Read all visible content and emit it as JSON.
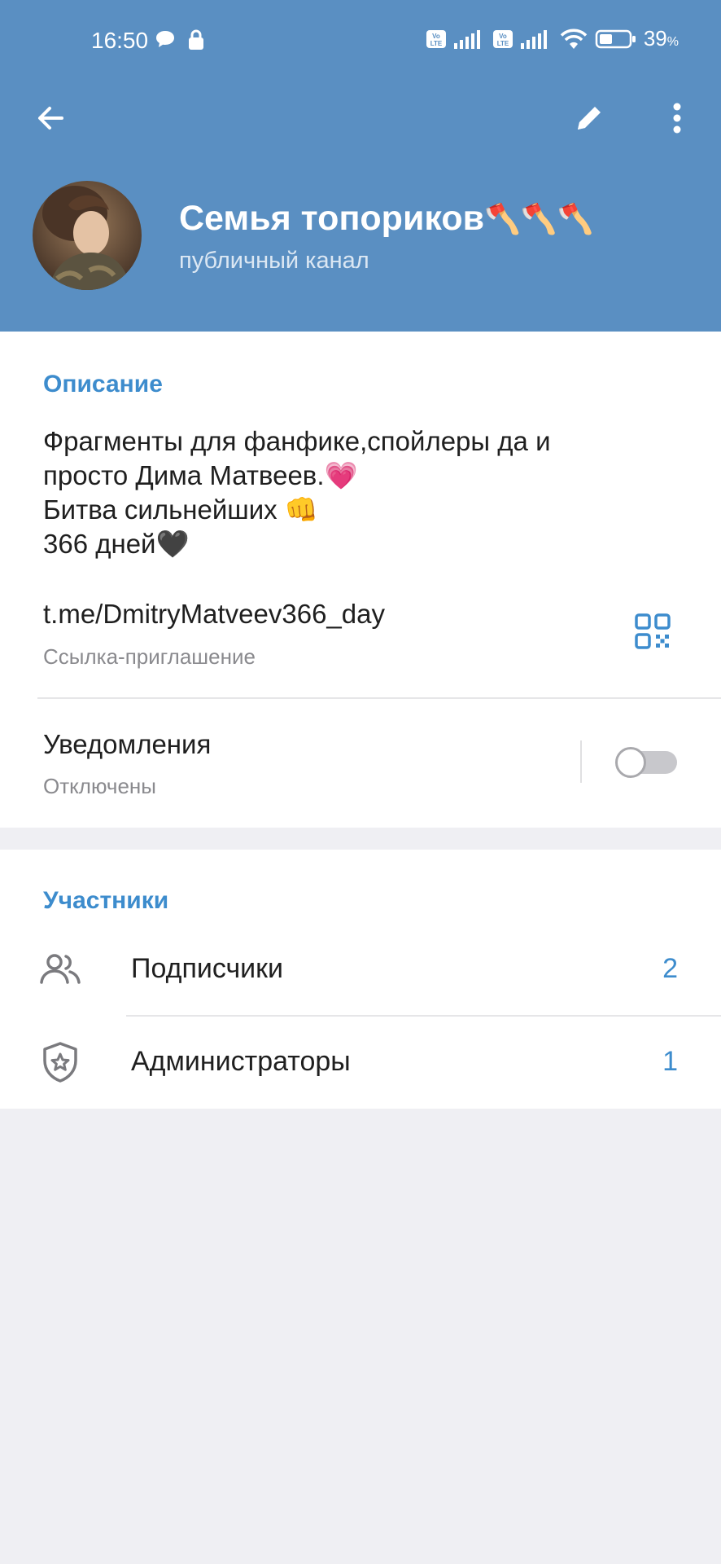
{
  "status_bar": {
    "time": "16:50",
    "battery_percent": "39",
    "battery_unit": "%",
    "icons": [
      "chat-bubble-icon",
      "lock-icon",
      "volte-icon",
      "signal-icon",
      "volte-icon",
      "signal-icon",
      "wifi-icon",
      "battery-icon"
    ]
  },
  "toolbar": {
    "back_icon": "arrow-left-icon",
    "edit_icon": "pencil-icon",
    "more_icon": "more-vertical-icon"
  },
  "channel": {
    "title": "Семья топориков",
    "title_emoji": "🪓🪓🪓",
    "subtitle": "публичный канал"
  },
  "info": {
    "section_title": "Описание",
    "description": "Фрагменты для фанфике,спойлеры да и\nпросто Дима Матвеев.💗\nБитва сильнейших 👊\n366 дней🖤",
    "link": "t.me/DmitryMatveev366_day",
    "link_caption": "Ссылка-приглашение",
    "qr_icon": "qr-code-icon",
    "notifications_label": "Уведомления",
    "notifications_state": "Отключены",
    "notifications_enabled": false
  },
  "members": {
    "section_title": "Участники",
    "rows": [
      {
        "label": "Подписчики",
        "count": "2",
        "icon": "users-icon"
      },
      {
        "label": "Администраторы",
        "count": "1",
        "icon": "shield-star-icon"
      }
    ]
  },
  "colors": {
    "header_bg": "#5a8fc2",
    "accent": "#3d8ccd",
    "page_bg": "#efeff3"
  }
}
